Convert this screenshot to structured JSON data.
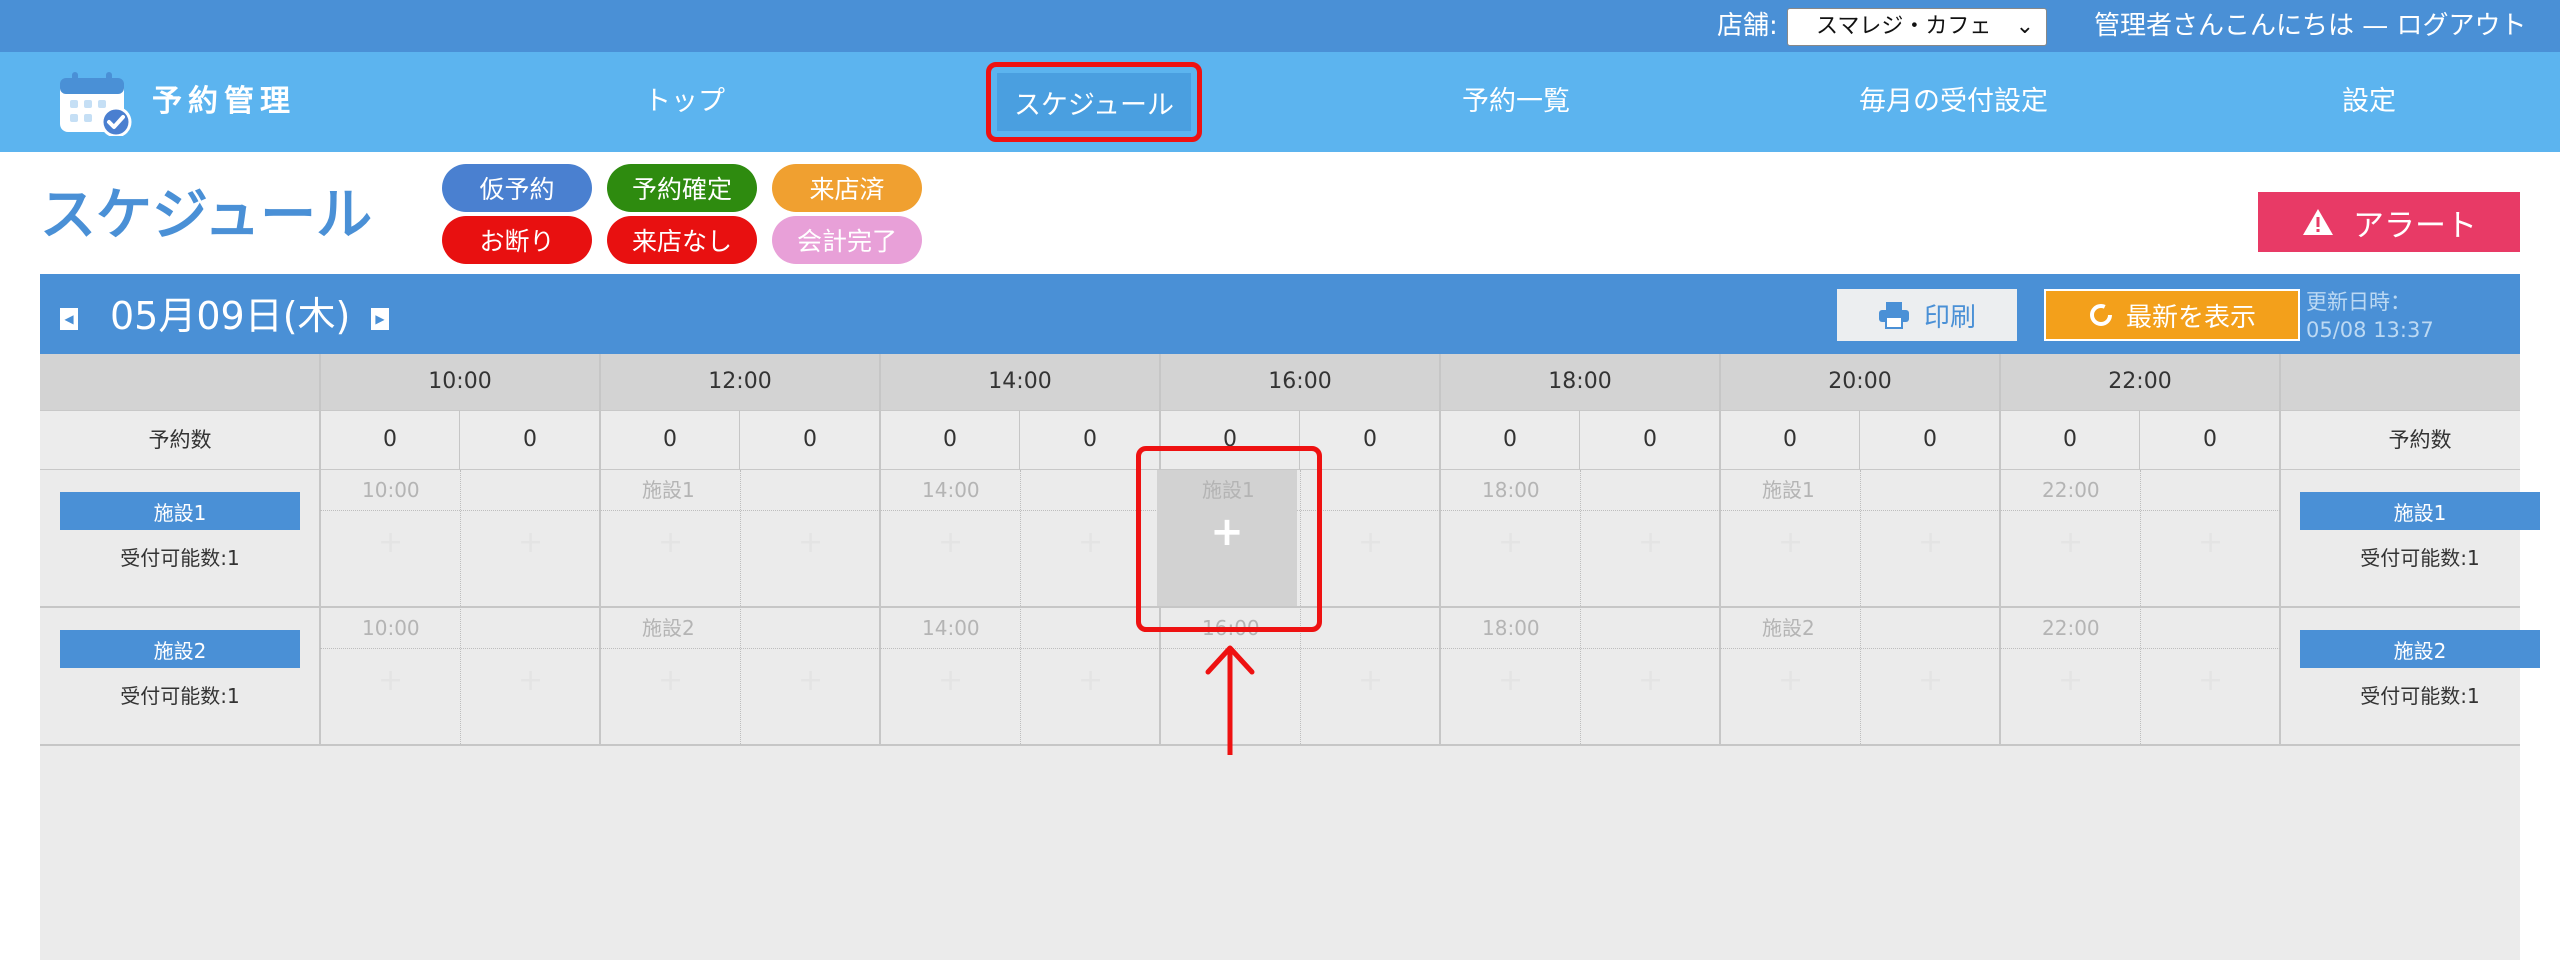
{
  "topbar": {
    "store_label": "店舗:",
    "store_selected": "スマレジ・カフェ",
    "greeting": "管理者さんこんにちは — ログアウト"
  },
  "nav": {
    "logo_text": "予約管理",
    "items": [
      {
        "label": "トップ"
      },
      {
        "label": "スケジュール",
        "active": true
      },
      {
        "label": "予約一覧"
      },
      {
        "label": "毎月の受付設定"
      },
      {
        "label": "設定"
      }
    ]
  },
  "page": {
    "title": "スケジュール",
    "statuses": [
      {
        "label": "仮予約",
        "color": "#4a80d0"
      },
      {
        "label": "予約確定",
        "color": "#2e8b0f"
      },
      {
        "label": "来店済",
        "color": "#f0a030"
      },
      {
        "label": "お断り",
        "color": "#e81010"
      },
      {
        "label": "来店なし",
        "color": "#e81010"
      },
      {
        "label": "会計完了",
        "color": "#e8a0d8"
      }
    ],
    "alert_label": "アラート"
  },
  "schedule": {
    "date": "05月09日(木)",
    "print_label": "印刷",
    "refresh_label": "最新を表示",
    "updated_label": "更新日時：",
    "updated_value": "05/08 13:37",
    "hours": [
      "10:00",
      "12:00",
      "14:00",
      "16:00",
      "18:00",
      "20:00",
      "22:00"
    ],
    "count_label": "予約数",
    "counts": [
      "0",
      "0",
      "0",
      "0",
      "0",
      "0",
      "0",
      "0",
      "0",
      "0",
      "0",
      "0",
      "0",
      "0"
    ],
    "facilities": [
      {
        "name": "施設1",
        "capacity": "受付可能数:1",
        "slot_labels": [
          "10:00",
          "施設1",
          "14:00",
          "施設1",
          "18:00",
          "施設1",
          "22:00"
        ]
      },
      {
        "name": "施設2",
        "capacity": "受付可能数:1",
        "slot_labels": [
          "10:00",
          "施設2",
          "14:00",
          "16:00",
          "18:00",
          "施設2",
          "22:00"
        ]
      }
    ],
    "highlight_plus": "+"
  },
  "colors": {
    "header_blue": "#4a90d6",
    "nav_blue": "#5cb4ef",
    "alert_pink": "#e83a66",
    "refresh_orange": "#f3a01b",
    "highlight_red": "#e11111"
  }
}
